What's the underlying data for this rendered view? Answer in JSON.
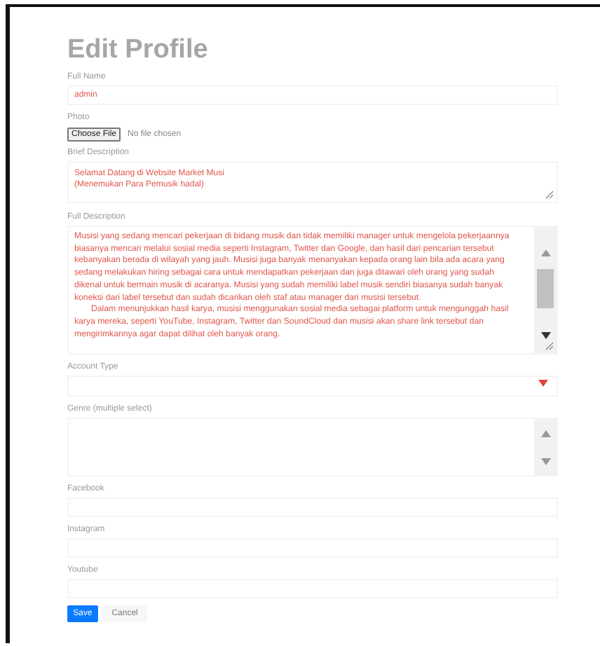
{
  "title": "Edit Profile",
  "fields": [
    {
      "kind": "text",
      "label": "Full Name",
      "value": "admin"
    },
    {
      "kind": "file",
      "label": "Photo",
      "button": "Choose File",
      "status": "No file chosen"
    },
    {
      "kind": "textarea",
      "label": "Brief Description",
      "lines": [
        "Selamat Datang di Website Market Musi",
        "(Menemukan Para Pemusik hadal)"
      ]
    },
    {
      "kind": "longtext",
      "label": "Full Description",
      "paragraphs": [
        "Musisi yang sedang mencari pekerjaan di bidang musik dan tidak memiliki manager untuk mengelola pekerjaannya biasanya mencari melalui sosial media seperti Instagram, Twitter dan Google, dan hasil dari pencarian tersebut kebanyakan berada di wilayah yang jauh. Musisi juga banyak menanyakan kepada orang lain bila ada acara yang sedang melakukan hiring sebagai cara untuk mendapatkan pekerjaan dan juga ditawari oleh orang yang sudah dikenal untuk bermain musik di acaranya. Musisi yang sudah memiliki label musik sendiri biasanya sudah banyak koneksi dari label tersebut dan sudah dicarikan oleh staf atau manager dari musisi tersebut.",
        "Dalam menunjukkan hasil karya, musisi menggunakan sosial media sebagai platform untuk mengunggah hasil karya mereka, seperti YouTube, Instagram, Twitter dan SoundCloud dan musisi akan share link tersebut dan mengirimkannya agar dapat dilihat oleh banyak orang."
      ]
    },
    {
      "kind": "select",
      "label": "Account Type"
    },
    {
      "kind": "multiselect",
      "label": "Genre (multiple select)"
    },
    {
      "kind": "text",
      "label": "Facebook"
    },
    {
      "kind": "text",
      "label": "Instagram"
    },
    {
      "kind": "text",
      "label": "Youtube"
    }
  ],
  "buttons": [
    {
      "label": "Save",
      "kind": "primary"
    },
    {
      "label": "Cancel",
      "kind": "secondary"
    }
  ]
}
